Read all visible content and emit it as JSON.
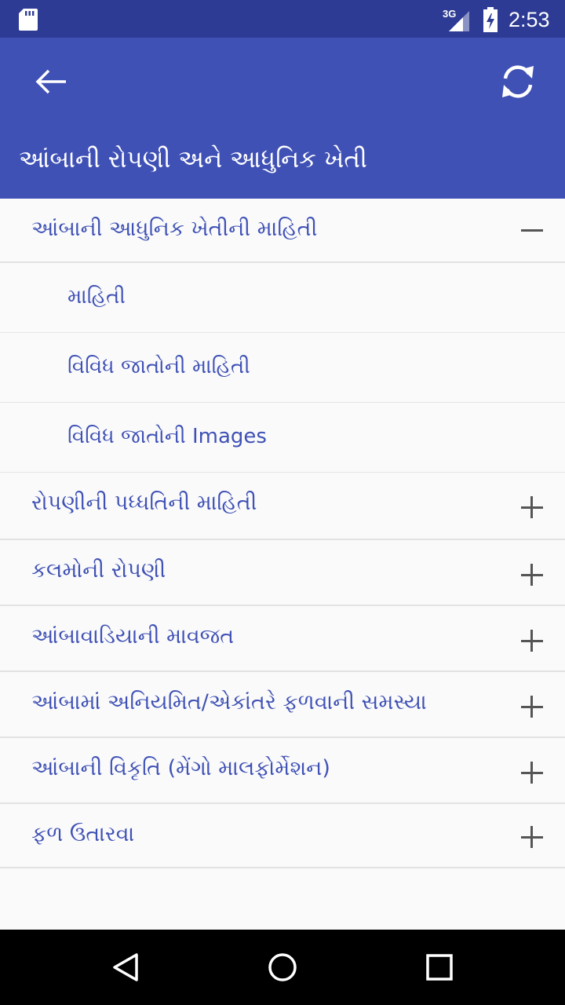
{
  "status_bar": {
    "time": "2:53",
    "network": "3G",
    "icons": [
      "sd-card-icon",
      "signal-icon",
      "battery-icon"
    ]
  },
  "app_bar": {
    "title": "આંબાની રોપણી અને આધુનિક ખેતી",
    "left_action": "back-arrow-icon",
    "right_action": "refresh-icon",
    "color": "#3f51b5"
  },
  "list": {
    "groups": [
      {
        "label": "આંબાની આધુનિક ખેતીની માહિતી",
        "expanded": true,
        "children": [
          {
            "label": "માહિતી"
          },
          {
            "label": "વિવિધ જાતોની માહિતી"
          },
          {
            "label": "વિવિધ જાતોની Images"
          }
        ]
      },
      {
        "label": "રોપણીની પધ્ધતિની માહિતી",
        "expanded": false
      },
      {
        "label": "કલમોની રોપણી",
        "expanded": false
      },
      {
        "label": "આંબાવાડિયાની માવજત",
        "expanded": false
      },
      {
        "label": "આંબામાં અનિયમિત/એકાંતરે ફળવાની સમસ્યા",
        "expanded": false
      },
      {
        "label": "આંબાની વિકૃતિ (મેંગો માલફોર્મેશન)",
        "expanded": false
      },
      {
        "label": "ફળ ઉતારવા",
        "expanded": false
      }
    ]
  },
  "nav_bar": {
    "buttons": [
      "back-triangle-icon",
      "home-circle-icon",
      "recents-square-icon"
    ]
  }
}
